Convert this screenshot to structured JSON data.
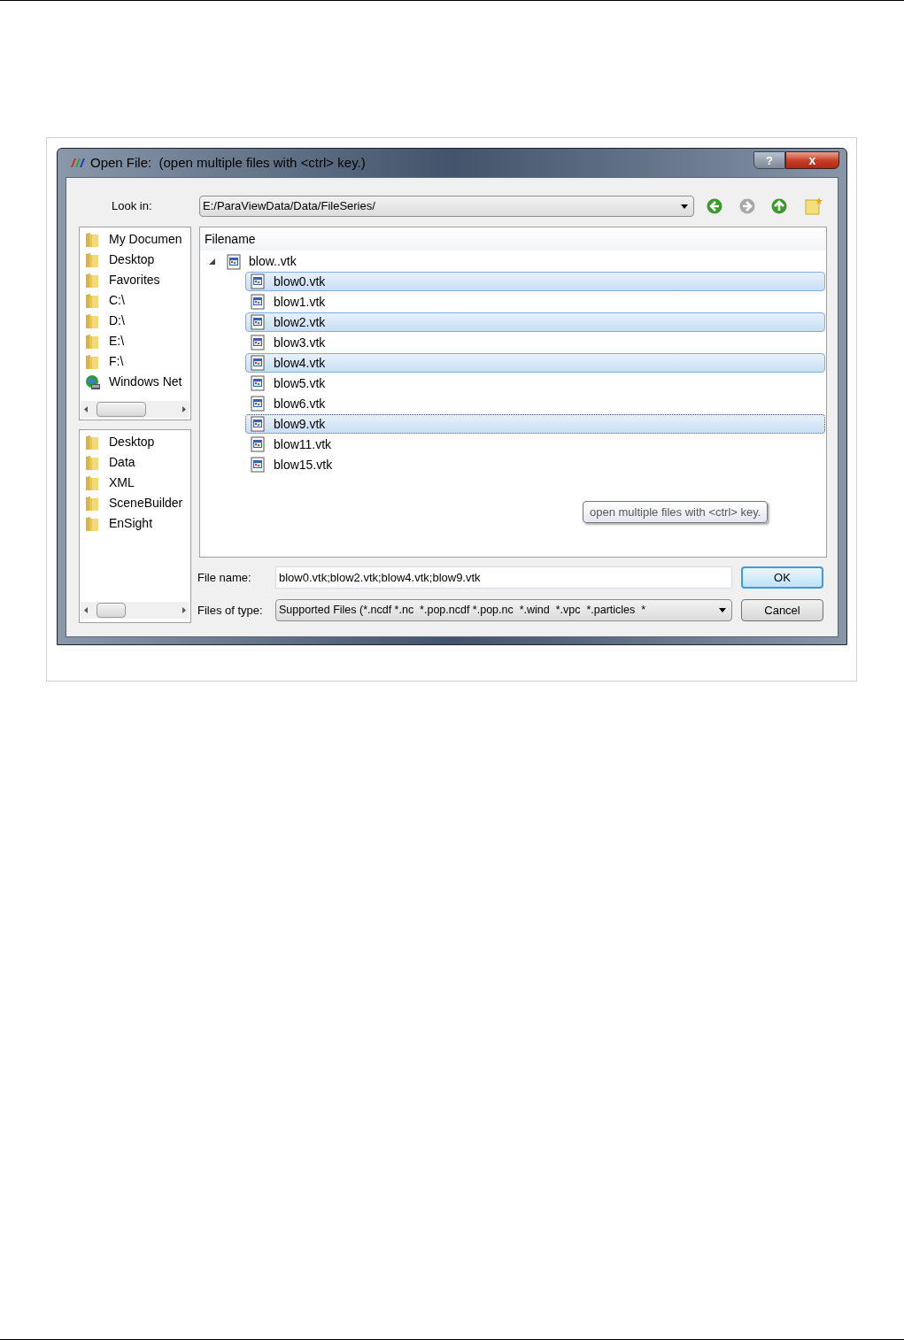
{
  "window": {
    "title": "Open File:  (open multiple files with <ctrl> key.)",
    "help_glyph": "?",
    "close_glyph": "x"
  },
  "look_in": {
    "label": "Look in:",
    "path": "E:/ParaViewData/Data/FileSeries/"
  },
  "places": [
    {
      "name": "My Documen",
      "kind": "folder"
    },
    {
      "name": "Desktop",
      "kind": "folder"
    },
    {
      "name": "Favorites",
      "kind": "folder"
    },
    {
      "name": "C:\\",
      "kind": "folder"
    },
    {
      "name": "D:\\",
      "kind": "folder"
    },
    {
      "name": "E:\\",
      "kind": "folder"
    },
    {
      "name": "F:\\",
      "kind": "folder"
    },
    {
      "name": "Windows Net",
      "kind": "network"
    }
  ],
  "recent": [
    {
      "name": "Desktop",
      "kind": "folder"
    },
    {
      "name": "Data",
      "kind": "folder"
    },
    {
      "name": "XML",
      "kind": "folder"
    },
    {
      "name": "SceneBuilder",
      "kind": "folder"
    },
    {
      "name": "EnSight",
      "kind": "folder"
    }
  ],
  "file_list": {
    "header": "Filename",
    "groups": [
      {
        "name": "blow..vtk",
        "expanded": true,
        "children": [
          {
            "name": "blow0.vtk",
            "selected": true,
            "focused": false
          },
          {
            "name": "blow1.vtk",
            "selected": false,
            "focused": false
          },
          {
            "name": "blow2.vtk",
            "selected": true,
            "focused": false
          },
          {
            "name": "blow3.vtk",
            "selected": false,
            "focused": false
          },
          {
            "name": "blow4.vtk",
            "selected": true,
            "focused": false
          },
          {
            "name": "blow5.vtk",
            "selected": false,
            "focused": false
          },
          {
            "name": "blow6.vtk",
            "selected": false,
            "focused": false
          },
          {
            "name": "blow9.vtk",
            "selected": true,
            "focused": true
          },
          {
            "name": "blow11.vtk",
            "selected": false,
            "focused": false
          },
          {
            "name": "blow15.vtk",
            "selected": false,
            "focused": false
          }
        ]
      }
    ]
  },
  "tooltip": "open multiple files with <ctrl> key.",
  "file_name": {
    "label": "File name:",
    "value": "blow0.vtk;blow2.vtk;blow4.vtk;blow9.vtk"
  },
  "files_of_type": {
    "label": "Files of type:",
    "value": "Supported Files (*.ncdf *.nc  *.pop.ncdf *.pop.nc  *.wind  *.vpc  *.particles  *"
  },
  "buttons": [
    {
      "label": "OK",
      "default": true
    },
    {
      "label": "Cancel",
      "default": false
    }
  ]
}
